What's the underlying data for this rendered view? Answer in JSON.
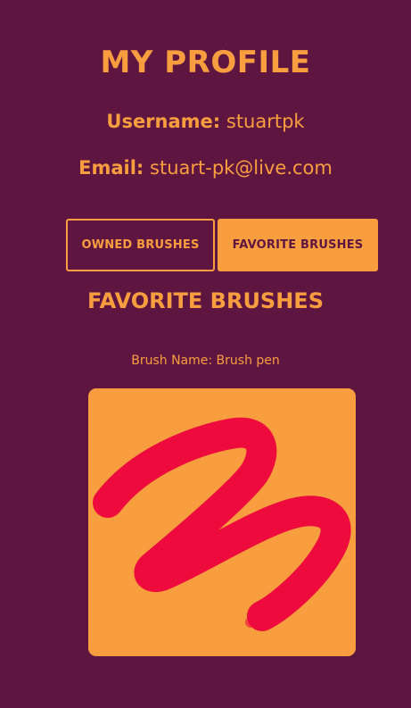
{
  "profile": {
    "title": "MY PROFILE",
    "username_label": "Username:",
    "username_value": "stuartpk",
    "email_label": "Email:",
    "email_value": "stuart-pk@live.com"
  },
  "tabs": {
    "owned_label": "OWNED BRUSHES",
    "favorite_label": "FAVORITE BRUSHES",
    "active": "favorite"
  },
  "favorites": {
    "section_title": "FAVORITE BRUSHES",
    "items": [
      {
        "name_line": "Brush Name: Brush pen",
        "image": "brush-pen-stroke"
      }
    ]
  },
  "colors": {
    "background": "#5e1641",
    "accent": "#f99e3f",
    "stroke": "#ee0a3c"
  }
}
